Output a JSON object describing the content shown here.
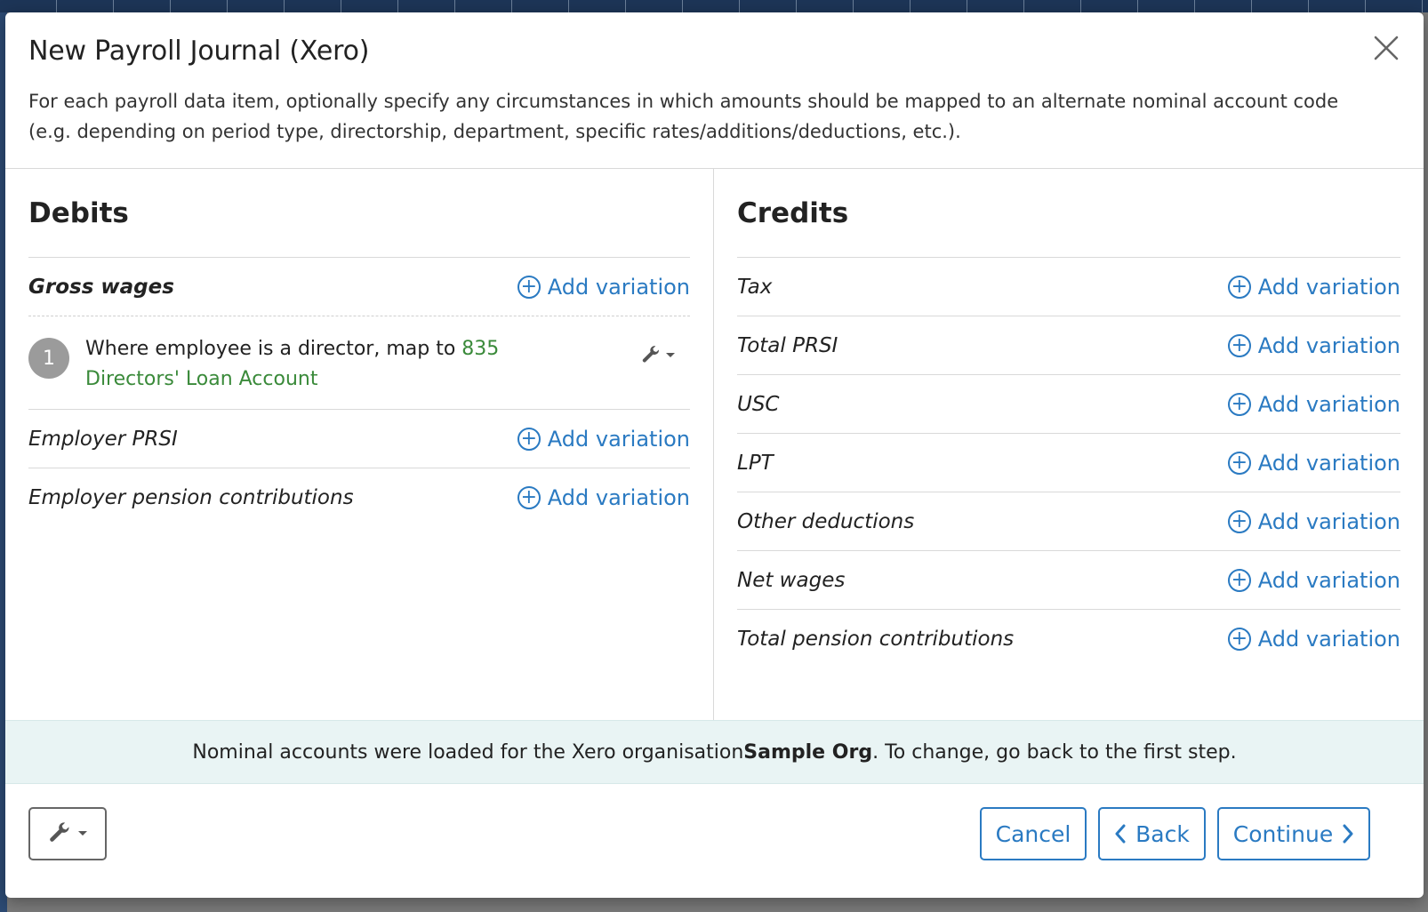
{
  "dialog": {
    "title": "New Payroll Journal (Xero)",
    "description": "For each payroll data item, optionally specify any circumstances in which amounts should be mapped to an alternate nominal account code (e.g. depending on period type, directorship, department, specific rates/additions/deductions, etc.)."
  },
  "add_variation_label": "Add variation",
  "debits": {
    "heading": "Debits",
    "items": [
      {
        "label": "Gross wages"
      },
      {
        "label": "Employer PRSI"
      },
      {
        "label": "Employer pension contributions"
      }
    ],
    "variation": {
      "number": "1",
      "text": "Where employee is a director, map to ",
      "account": "835 Directors' Loan Account"
    }
  },
  "credits": {
    "heading": "Credits",
    "items": [
      {
        "label": "Tax"
      },
      {
        "label": "Total PRSI"
      },
      {
        "label": "USC"
      },
      {
        "label": "LPT"
      },
      {
        "label": "Other deductions"
      },
      {
        "label": "Net wages"
      },
      {
        "label": "Total pension contributions"
      }
    ]
  },
  "notice": {
    "prefix": "Nominal accounts were loaded for the Xero organisation ",
    "org": "Sample Org",
    "suffix": ". To change, go back to the first step."
  },
  "footer": {
    "cancel": "Cancel",
    "back": "Back",
    "continue": "Continue"
  },
  "colors": {
    "link": "#2a7ac2",
    "account_link": "#3a8a3a",
    "notice_bg": "#e9f4f4"
  }
}
